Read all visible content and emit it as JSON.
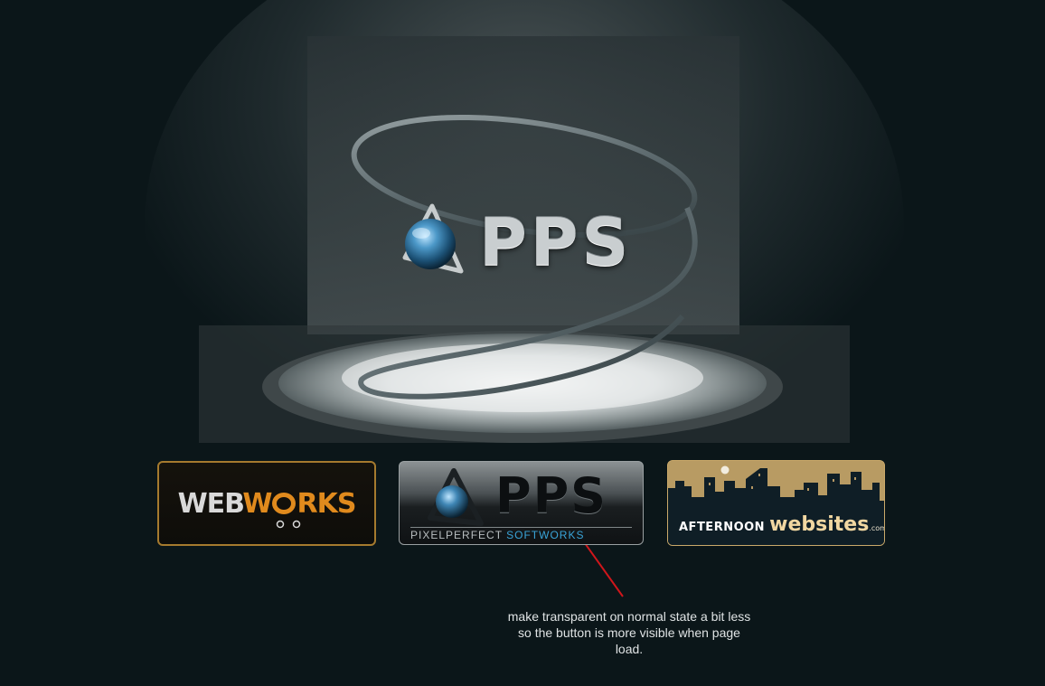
{
  "hero": {
    "logo_text": "PPS"
  },
  "tiles": {
    "webworks": {
      "part1": "WEB",
      "part2": "W",
      "part3": "RKS"
    },
    "pps": {
      "big": "PPS",
      "sub_part1": "PIXELPERFECT ",
      "sub_part2": "SOFTWORKS"
    },
    "afternoon": {
      "small": "AFTERNOON",
      "big": "websites",
      "tld": ".com"
    }
  },
  "annotation": {
    "text": "make transparent on normal state a bit less so the button is more visible when page load."
  },
  "colors": {
    "background": "#0b1619",
    "webworks_orange": "#e08a1d",
    "webworks_border": "#a57a2e",
    "pps_blue": "#39a4d8",
    "afternoon_gold": "#b89b63",
    "arrow_red": "#d0161b"
  }
}
